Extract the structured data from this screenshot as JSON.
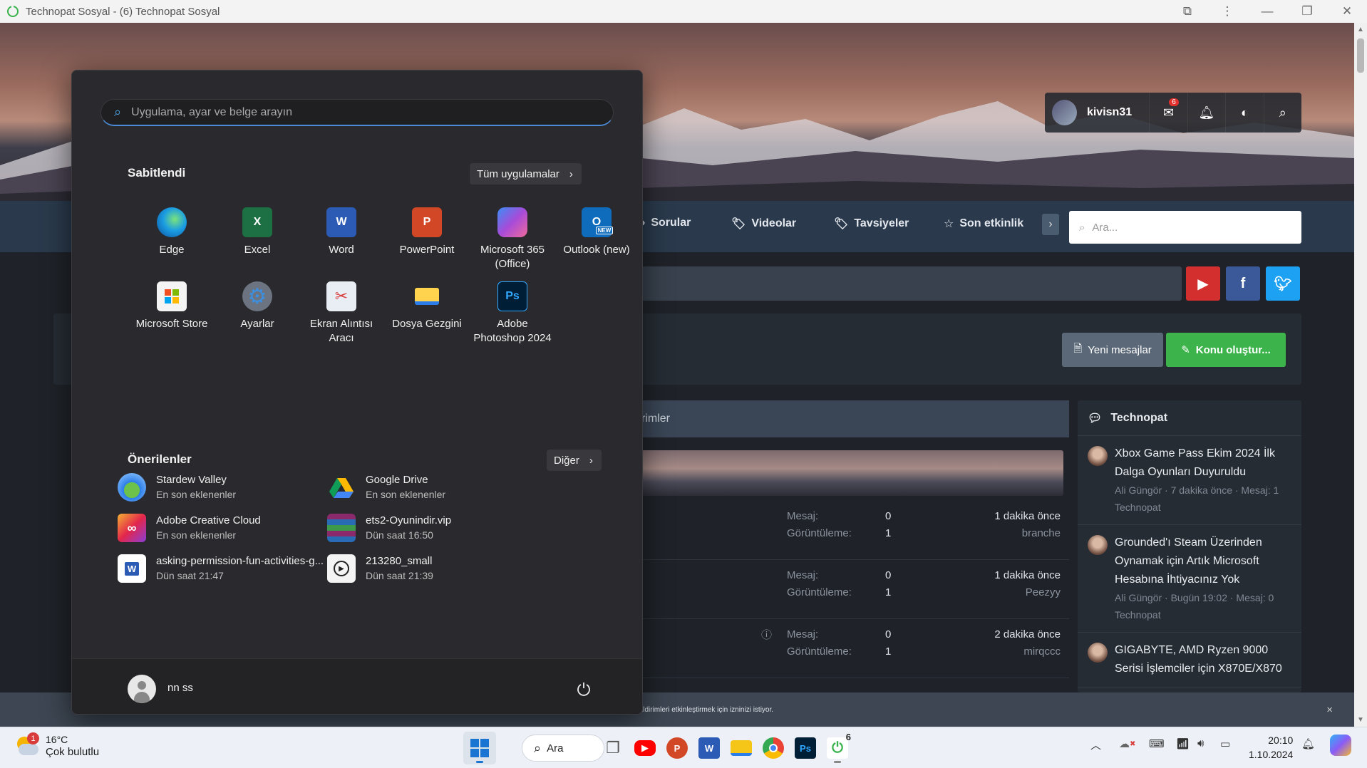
{
  "browser": {
    "title": "Technopat Sosyal - (6) Technopat Sosyal",
    "buttons": [
      "extensions",
      "menu",
      "minimize",
      "restore",
      "close"
    ]
  },
  "website": {
    "user": {
      "name": "kivisn31",
      "messages_badge": "6"
    },
    "nav": [
      "Sorular",
      "Videolar",
      "Tavsiyeler",
      "Son etkinlik"
    ],
    "search_placeholder": "Ara...",
    "buttons": {
      "new_messages": "Yeni mesajlar",
      "create_topic": "Konu oluştur..."
    },
    "feed_header": "rimler",
    "feed_labels": {
      "messages": "Mesaj:",
      "views": "Görüntüleme:"
    },
    "feed_rows": [
      {
        "messages": "0",
        "views": "1",
        "time": "1 dakika önce",
        "user": "branche"
      },
      {
        "messages": "0",
        "views": "1",
        "time": "1 dakika önce",
        "user": "Peezyy"
      },
      {
        "messages": "0",
        "views": "1",
        "time": "2 dakika önce",
        "user": "mirqccc"
      }
    ],
    "sidebar": {
      "title": "Technopat",
      "items": [
        {
          "title": "Xbox Game Pass Ekim 2024 İlk Dalga Oyunları Duyuruldu",
          "meta": "Ali Güngör · 7 dakika önce · Mesaj: 1",
          "forum": "Technopat"
        },
        {
          "title": "Grounded'ı Steam Üzerinden Oynamak için Artık Microsoft Hesabına İhtiyacınız Yok",
          "meta": "Ali Güngör · Bugün 19:02 · Mesaj: 0",
          "forum": "Technopat"
        },
        {
          "title": "GIGABYTE, AMD Ryzen 9000 Serisi İşlemciler için X870E/X870",
          "meta": "",
          "forum": ""
        }
      ]
    },
    "cookie_text": "ildirimleri etkinleştirmek için izninizi istiyor.",
    "cookie_close": "×"
  },
  "start_menu": {
    "search_placeholder": "Uygulama, ayar ve belge arayın",
    "pinned_title": "Sabitlendi",
    "all_apps": "Tüm uygulamalar",
    "pinned": [
      {
        "label": "Edge",
        "icon": "edge-icon",
        "color": "#1b9de2"
      },
      {
        "label": "Excel",
        "icon": "excel-icon",
        "color": "#1d7044",
        "glyph": "X"
      },
      {
        "label": "Word",
        "icon": "word-icon",
        "color": "#2b5bb5",
        "glyph": "W"
      },
      {
        "label": "PowerPoint",
        "icon": "powerpoint-icon",
        "color": "#d24726",
        "glyph": "P"
      },
      {
        "label": "Microsoft 365\n(Office)",
        "icon": "microsoft-365-icon",
        "color": "#7b4fd6"
      },
      {
        "label": "Outlook (new)",
        "icon": "outlook-icon",
        "color": "#0f6cbd",
        "glyph": "O"
      },
      {
        "label": "Microsoft Store",
        "icon": "store-icon",
        "color": "#f4f4f4"
      },
      {
        "label": "Ayarlar",
        "icon": "settings-gear-icon",
        "color": "#6b7480",
        "glyph": "⚙"
      },
      {
        "label": "Ekran Alıntısı\nAracı",
        "icon": "snipping-tool-icon",
        "color": "#e9eef5"
      },
      {
        "label": "Dosya Gezgini",
        "icon": "file-explorer-icon",
        "color": "#f5c518"
      },
      {
        "label": "Adobe\nPhotoshop 2024",
        "icon": "photoshop-icon",
        "color": "#001e36",
        "glyph": "Ps"
      }
    ],
    "recommended_title": "Önerilenler",
    "more": "Diğer",
    "recommended": [
      {
        "name": "Stardew Valley",
        "sub": "En son eklenenler",
        "icon": "stardew-valley-icon",
        "color": "#3b7bd4"
      },
      {
        "name": "Google Drive",
        "sub": "En son eklenenler",
        "icon": "google-drive-icon",
        "color": "#2a2a2e"
      },
      {
        "name": "Adobe Creative Cloud",
        "sub": "En son eklenenler",
        "icon": "creative-cloud-icon",
        "color": "#e3264b"
      },
      {
        "name": "ets2-Oyunindir.vip",
        "sub": "Dün saat 16:50",
        "icon": "winrar-icon",
        "color": "#8a2a6b"
      },
      {
        "name": "asking-permission-fun-activities-g...",
        "sub": "Dün saat 21:47",
        "icon": "word-document-icon",
        "color": "#2b5bb5"
      },
      {
        "name": "213280_small",
        "sub": "Dün saat 21:39",
        "icon": "video-file-icon",
        "color": "#f4f4f4"
      }
    ],
    "user": "nn ss"
  },
  "taskbar": {
    "weather": {
      "temp": "16°C",
      "condition": "Çok bulutlu",
      "badge": "1"
    },
    "search": "Ara",
    "apps": [
      {
        "name": "task-view-icon",
        "color": "#555"
      },
      {
        "name": "youtube-icon",
        "color": "#ff0000"
      },
      {
        "name": "powerpoint-icon",
        "color": "#d24726"
      },
      {
        "name": "word-icon",
        "color": "#2b5bb5"
      },
      {
        "name": "file-explorer-icon",
        "color": "#f5c518"
      },
      {
        "name": "chrome-icon",
        "color": "#34a853"
      },
      {
        "name": "photoshop-icon",
        "color": "#001e36"
      },
      {
        "name": "technopat-icon",
        "color": "#38b24a"
      }
    ],
    "technopat_badge": "6",
    "time": "20:10",
    "date": "1.10.2024"
  }
}
